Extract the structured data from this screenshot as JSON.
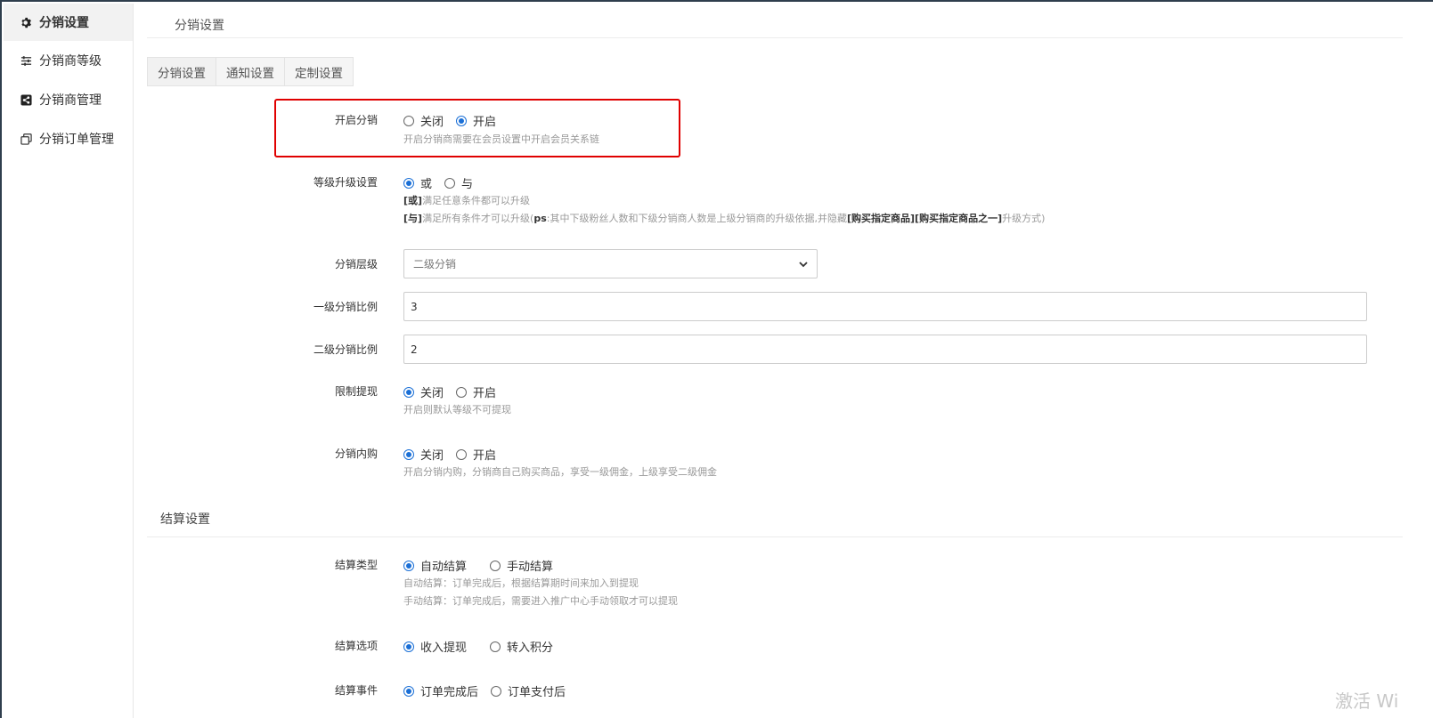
{
  "sidebar": {
    "items": [
      {
        "label": "分销设置",
        "icon": "gear-icon"
      },
      {
        "label": "分销商等级",
        "icon": "sliders-icon"
      },
      {
        "label": "分销商管理",
        "icon": "share-icon"
      },
      {
        "label": "分销订单管理",
        "icon": "copy-icon"
      }
    ]
  },
  "page": {
    "title": "分销设置",
    "tabs": [
      "分销设置",
      "通知设置",
      "定制设置"
    ]
  },
  "form": {
    "enable_distribution": {
      "label": "开启分销",
      "options": [
        "关闭",
        "开启"
      ],
      "selected": "开启",
      "help": "开启分销商需要在会员设置中开启会员关系链"
    },
    "upgrade_setting": {
      "label": "等级升级设置",
      "options": [
        "或",
        "与"
      ],
      "selected": "或",
      "help1_tag": "[或]",
      "help1_text": "满足任意条件都可以升级",
      "help2_tag": "[与]",
      "help2_text_a": "满足所有条件才可以升级(",
      "help2_ps": "ps",
      "help2_text_b": ":其中下级粉丝人数和下级分销商人数是上级分销商的升级依据,并隐藏",
      "help2_bold1": "[购买指定商品]",
      "help2_bold2": "[购买指定商品之一]",
      "help2_text_c": "升级方式)"
    },
    "level": {
      "label": "分销层级",
      "value": "二级分销"
    },
    "level1_ratio": {
      "label": "一级分销比例",
      "value": "3"
    },
    "level2_ratio": {
      "label": "二级分销比例",
      "value": "2"
    },
    "limit_withdraw": {
      "label": "限制提现",
      "options": [
        "关闭",
        "开启"
      ],
      "selected": "关闭",
      "help": "开启则默认等级不可提现"
    },
    "self_purchase": {
      "label": "分销内购",
      "options": [
        "关闭",
        "开启"
      ],
      "selected": "关闭",
      "help": "开启分销内购，分销商自己购买商品，享受一级佣金，上级享受二级佣金"
    }
  },
  "settlement": {
    "title": "结算设置",
    "type": {
      "label": "结算类型",
      "options": [
        "自动结算",
        "手动结算"
      ],
      "selected": "自动结算",
      "help1": "自动结算：订单完成后，根据结算期时间来加入到提现",
      "help2": "手动结算：订单完成后，需要进入推广中心手动领取才可以提现"
    },
    "option": {
      "label": "结算选项",
      "options": [
        "收入提现",
        "转入积分"
      ],
      "selected": "收入提现"
    },
    "event": {
      "label": "结算事件",
      "options": [
        "订单完成后",
        "订单支付后"
      ],
      "selected": "订单完成后"
    }
  },
  "watermark": "激活 Wi",
  "colors": {
    "accent": "#1a6fd6",
    "highlight": "#e00000"
  }
}
